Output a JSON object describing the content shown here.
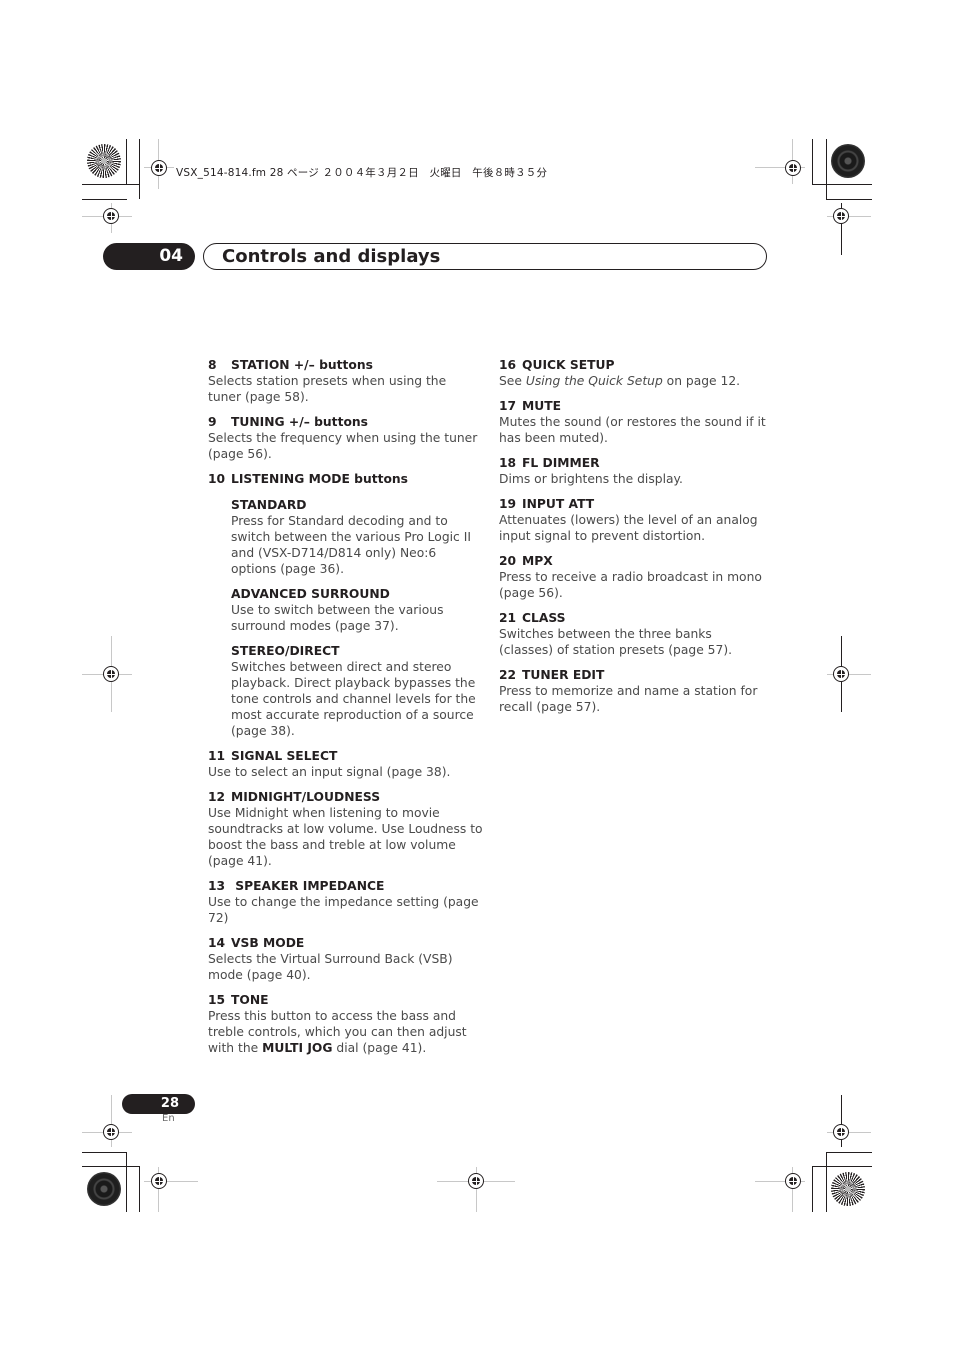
{
  "print_header": "VSX_514-814.fm  28 ページ  ２００４年３月２日　火曜日　午後８時３５分",
  "chapter": {
    "number": "04",
    "title": "Controls and displays"
  },
  "left_column": [
    {
      "num": "8",
      "title": "STATION +/– buttons",
      "body": "Selects station presets when using the tuner (page 58)."
    },
    {
      "num": "9",
      "title": "TUNING +/– buttons",
      "body": "Selects the frequency when using the tuner (page 56)."
    },
    {
      "num": "10",
      "title": "LISTENING MODE buttons",
      "body": "",
      "subitems": [
        {
          "title": "STANDARD",
          "body": "Press for Standard decoding and to switch between the various Pro Logic II and (VSX-D714/D814 only) Neo:6 options (page 36)."
        },
        {
          "title": "ADVANCED SURROUND",
          "body": "Use to switch between the various surround modes (page 37)."
        },
        {
          "title": "STEREO/DIRECT",
          "body": "Switches between direct and stereo playback. Direct playback bypasses the tone controls and channel levels for the most accurate reproduction of a source (page 38)."
        }
      ]
    },
    {
      "num": "11",
      "title": "SIGNAL SELECT",
      "body": "Use to select an input signal (page 38)."
    },
    {
      "num": "12",
      "title": "MIDNIGHT/LOUDNESS",
      "body": "Use Midnight when listening to movie soundtracks at low volume. Use Loudness to boost the bass and treble at low volume (page 41)."
    },
    {
      "num": "13",
      "title": " SPEAKER IMPEDANCE",
      "body": "Use to change the impedance setting (page 72)"
    },
    {
      "num": "14",
      "title": "VSB MODE",
      "body": "Selects the Virtual Surround Back (VSB) mode (page 40)."
    },
    {
      "num": "15",
      "title": "TONE",
      "body_pre": "Press this button to access the bass and treble controls, which you can then adjust with the ",
      "body_bold": "MULTI JOG",
      "body_post": " dial (page 41)."
    }
  ],
  "right_column": [
    {
      "num": "16",
      "title": "QUICK SETUP",
      "body_pre": "See ",
      "body_italic": "Using the Quick Setup",
      "body_post": " on page 12."
    },
    {
      "num": "17",
      "title": "MUTE",
      "body": "Mutes the sound (or restores the sound if it has been muted)."
    },
    {
      "num": "18",
      "title": "FL DIMMER",
      "body": "Dims or brightens the display."
    },
    {
      "num": "19",
      "title": "INPUT ATT",
      "body": "Attenuates (lowers) the level of an analog input signal to prevent distortion."
    },
    {
      "num": "20",
      "title": "MPX",
      "body": "Press to receive a radio broadcast in mono (page 56)."
    },
    {
      "num": "21",
      "title": "CLASS",
      "body": "Switches between the three banks (classes) of station presets (page 57)."
    },
    {
      "num": "22",
      "title": "TUNER EDIT",
      "body": "Press to memorize and name a station for recall (page 57)."
    }
  ],
  "footer": {
    "page_number": "28",
    "language": "En"
  }
}
